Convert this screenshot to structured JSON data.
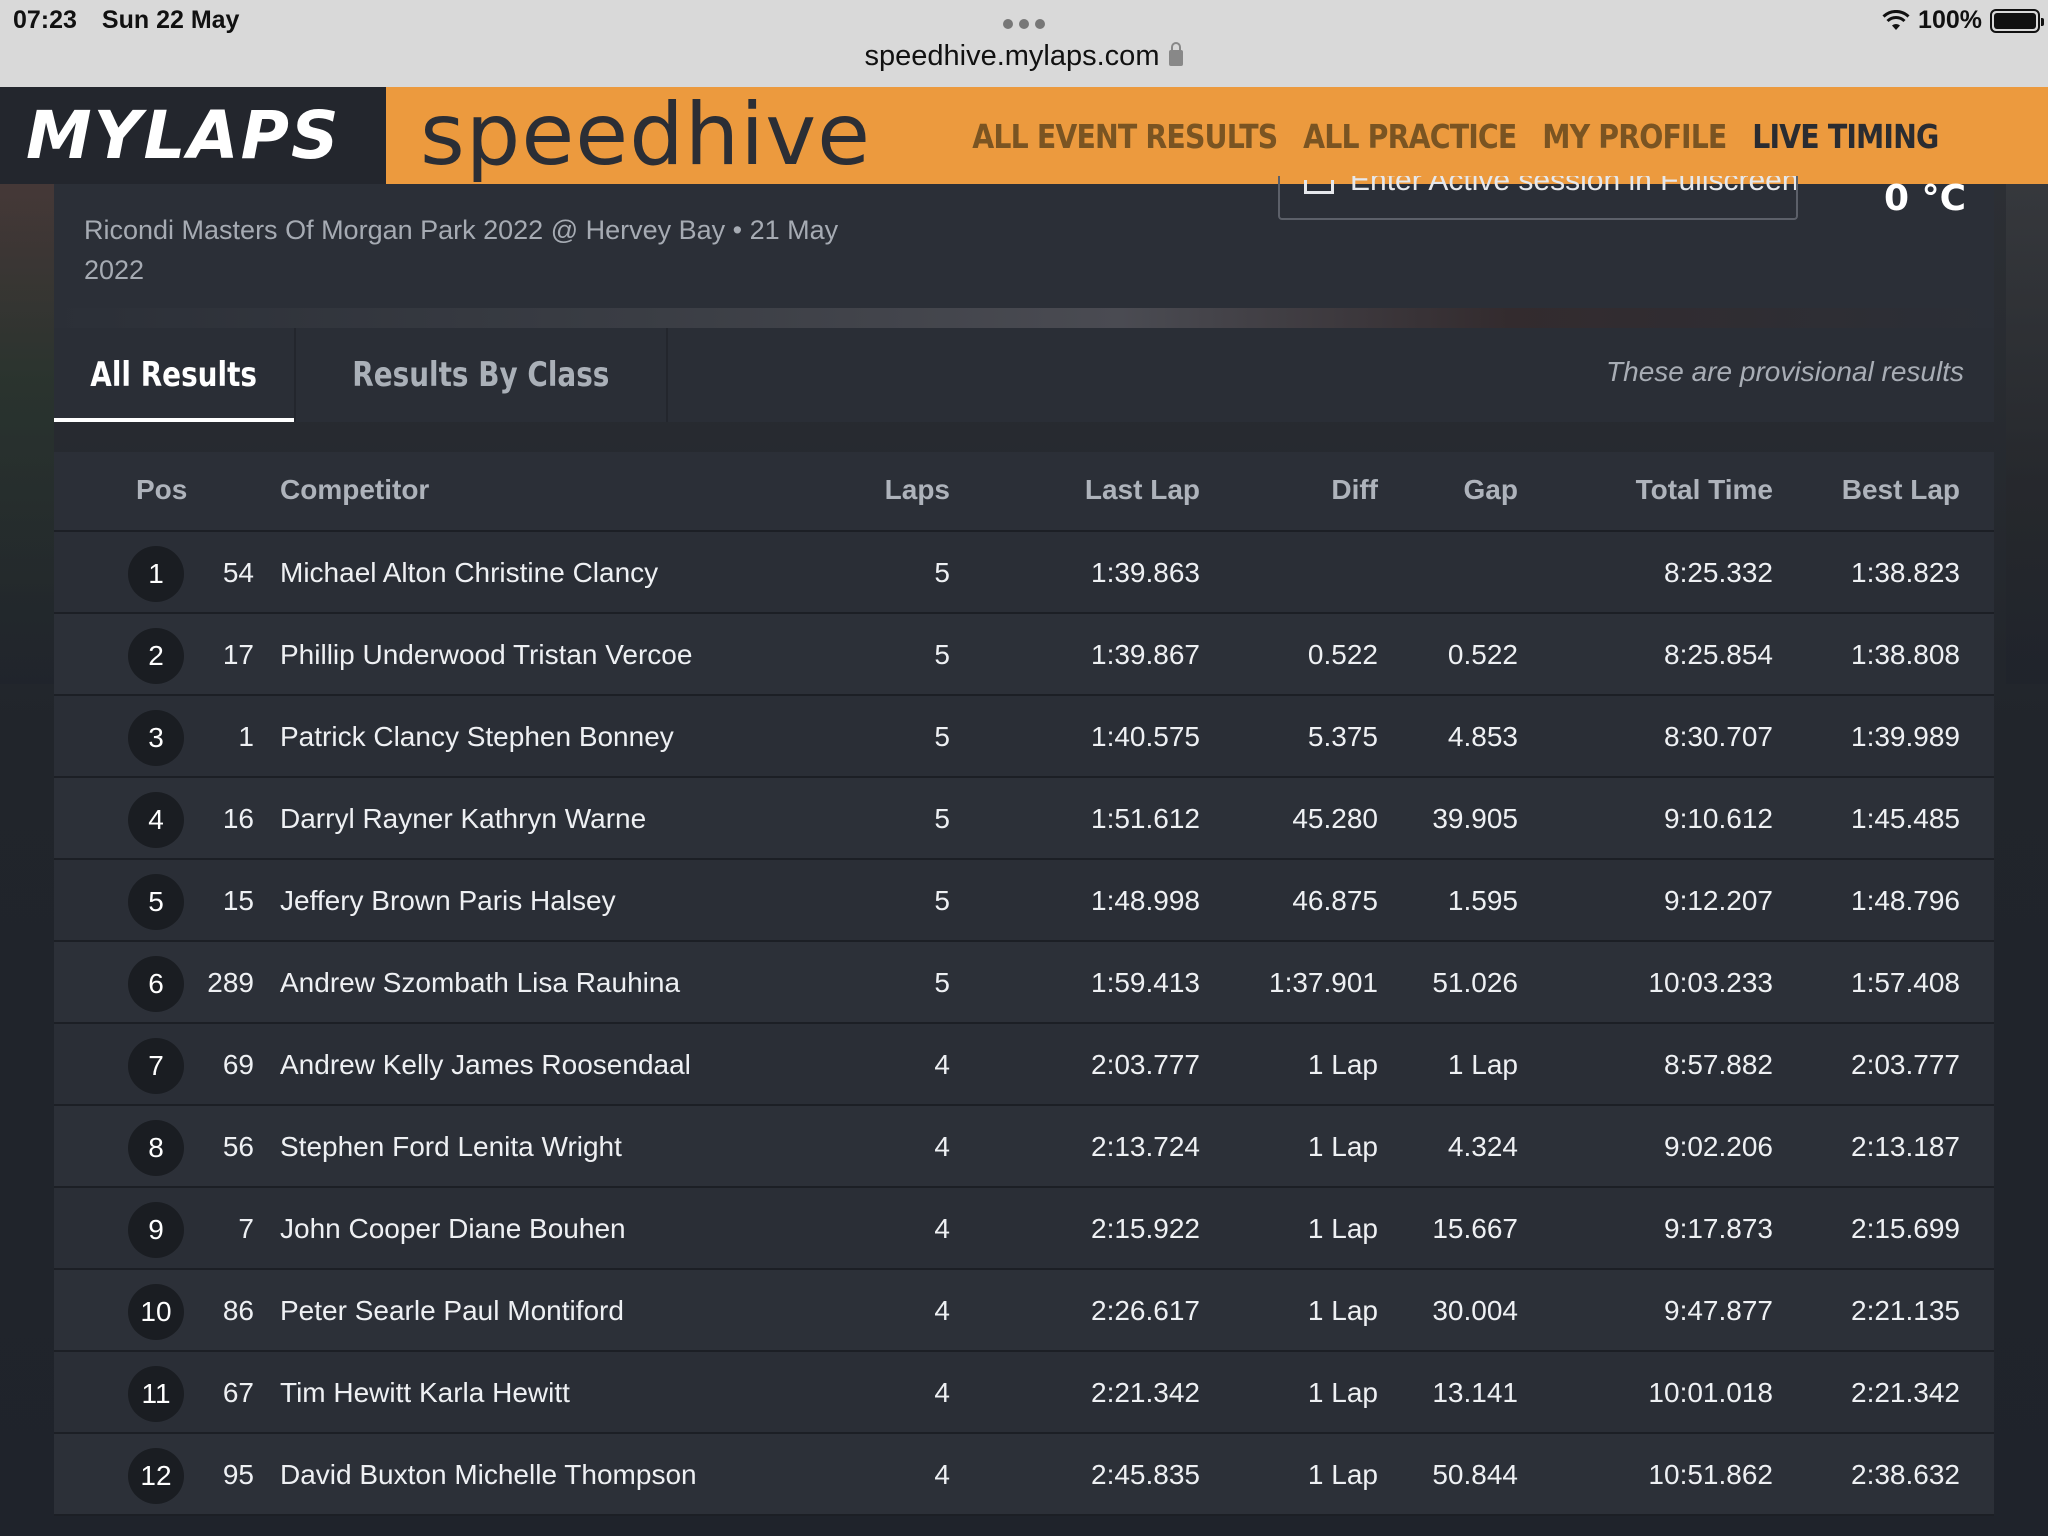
{
  "statusbar": {
    "time": "07:23",
    "date": "Sun 22 May",
    "url": "speedhive.mylaps.com",
    "battery": "100%"
  },
  "header": {
    "brand": "MYLAPS",
    "product": "speedhive",
    "nav": [
      "ALL EVENT RESULTS",
      "ALL PRACTICE",
      "MY PROFILE",
      "LIVE TIMING"
    ],
    "active_nav": "LIVE TIMING"
  },
  "event": {
    "title": "Ricondi Masters Of Morgan Park 2022 @ Hervey Bay • 21 May 2022",
    "fullscreen_label": "Enter Active session in Fullscreen",
    "temperature": "0 °C"
  },
  "tabs": {
    "all": "All Results",
    "by_class": "Results By Class",
    "notice": "These are provisional results"
  },
  "table": {
    "headers": {
      "pos": "Pos",
      "competitor": "Competitor",
      "laps": "Laps",
      "last_lap": "Last Lap",
      "diff": "Diff",
      "gap": "Gap",
      "total_time": "Total Time",
      "best_lap": "Best Lap"
    },
    "rows": [
      {
        "pos": "1",
        "num": "54",
        "competitor": "Michael Alton Christine Clancy",
        "laps": "5",
        "last_lap": "1:39.863",
        "diff": "",
        "gap": "",
        "total": "8:25.332",
        "best": "1:38.823"
      },
      {
        "pos": "2",
        "num": "17",
        "competitor": "Phillip Underwood Tristan Vercoe",
        "laps": "5",
        "last_lap": "1:39.867",
        "diff": "0.522",
        "gap": "0.522",
        "total": "8:25.854",
        "best": "1:38.808"
      },
      {
        "pos": "3",
        "num": "1",
        "competitor": "Patrick Clancy Stephen Bonney",
        "laps": "5",
        "last_lap": "1:40.575",
        "diff": "5.375",
        "gap": "4.853",
        "total": "8:30.707",
        "best": "1:39.989"
      },
      {
        "pos": "4",
        "num": "16",
        "competitor": "Darryl Rayner Kathryn Warne",
        "laps": "5",
        "last_lap": "1:51.612",
        "diff": "45.280",
        "gap": "39.905",
        "total": "9:10.612",
        "best": "1:45.485"
      },
      {
        "pos": "5",
        "num": "15",
        "competitor": "Jeffery Brown Paris Halsey",
        "laps": "5",
        "last_lap": "1:48.998",
        "diff": "46.875",
        "gap": "1.595",
        "total": "9:12.207",
        "best": "1:48.796"
      },
      {
        "pos": "6",
        "num": "289",
        "competitor": "Andrew Szombath Lisa Rauhina",
        "laps": "5",
        "last_lap": "1:59.413",
        "diff": "1:37.901",
        "gap": "51.026",
        "total": "10:03.233",
        "best": "1:57.408"
      },
      {
        "pos": "7",
        "num": "69",
        "competitor": "Andrew Kelly James Roosendaal",
        "laps": "4",
        "last_lap": "2:03.777",
        "diff": "1 Lap",
        "gap": "1 Lap",
        "total": "8:57.882",
        "best": "2:03.777"
      },
      {
        "pos": "8",
        "num": "56",
        "competitor": "Stephen Ford Lenita Wright",
        "laps": "4",
        "last_lap": "2:13.724",
        "diff": "1 Lap",
        "gap": "4.324",
        "total": "9:02.206",
        "best": "2:13.187"
      },
      {
        "pos": "9",
        "num": "7",
        "competitor": "John Cooper Diane Bouhen",
        "laps": "4",
        "last_lap": "2:15.922",
        "diff": "1 Lap",
        "gap": "15.667",
        "total": "9:17.873",
        "best": "2:15.699"
      },
      {
        "pos": "10",
        "num": "86",
        "competitor": "Peter Searle Paul Montiford",
        "laps": "4",
        "last_lap": "2:26.617",
        "diff": "1 Lap",
        "gap": "30.004",
        "total": "9:47.877",
        "best": "2:21.135"
      },
      {
        "pos": "11",
        "num": "67",
        "competitor": "Tim Hewitt Karla Hewitt",
        "laps": "4",
        "last_lap": "2:21.342",
        "diff": "1 Lap",
        "gap": "13.141",
        "total": "10:01.018",
        "best": "2:21.342"
      },
      {
        "pos": "12",
        "num": "95",
        "competitor": "David Buxton Michelle Thompson",
        "laps": "4",
        "last_lap": "2:45.835",
        "diff": "1 Lap",
        "gap": "50.844",
        "total": "10:51.862",
        "best": "2:38.632"
      }
    ]
  },
  "colors": {
    "accent": "#ec9a3e",
    "background": "#1f232b",
    "panel": "#2b2f37"
  }
}
